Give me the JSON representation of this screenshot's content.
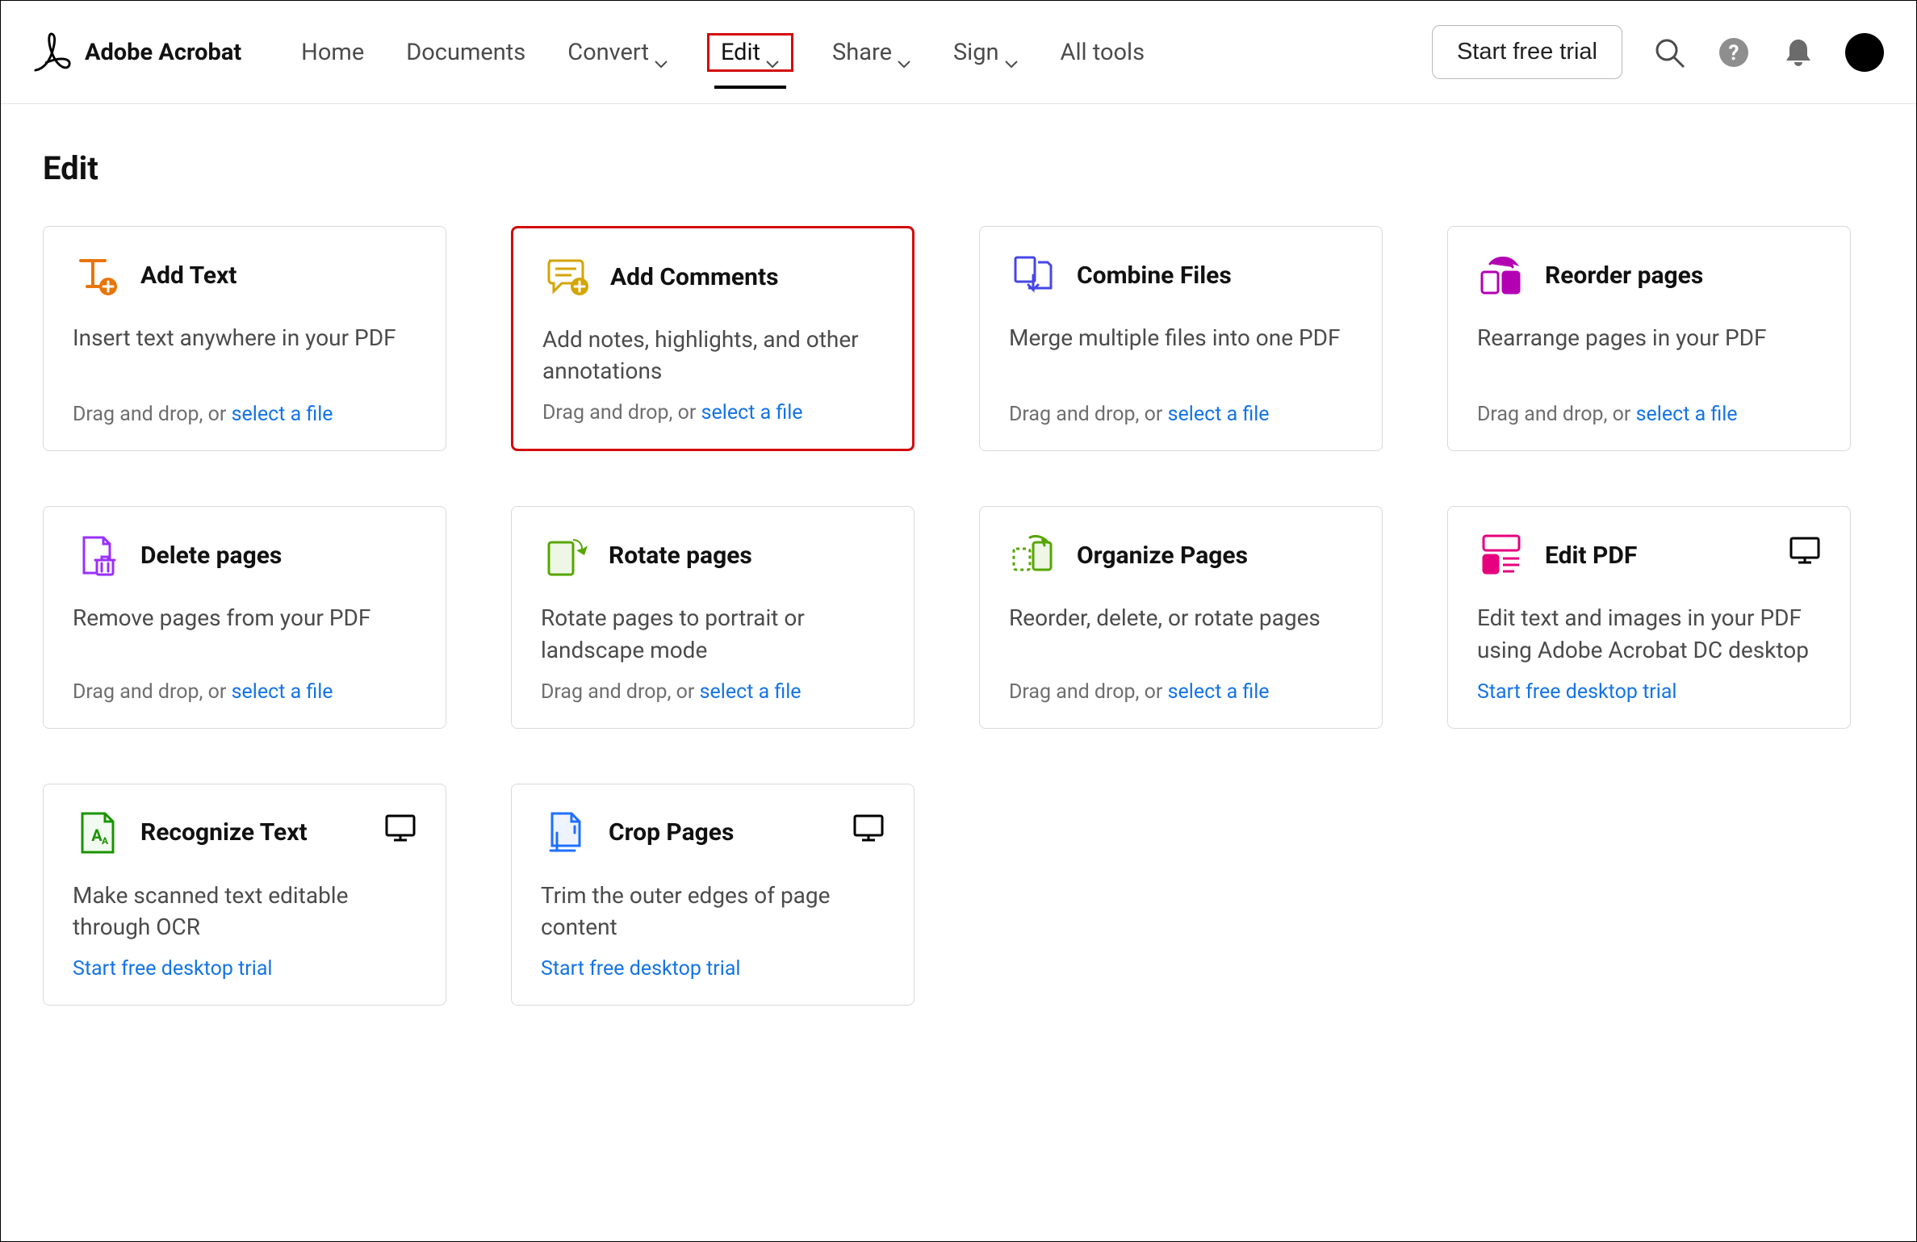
{
  "brand": {
    "name": "Adobe Acrobat"
  },
  "nav": {
    "home": "Home",
    "documents": "Documents",
    "convert": "Convert",
    "edit": "Edit",
    "share": "Share",
    "sign": "Sign",
    "alltools": "All tools"
  },
  "cta": {
    "start": "Start free trial"
  },
  "page": {
    "title": "Edit",
    "drag_prefix": "Drag and drop, or ",
    "select_file": "select a file",
    "desktop_trial": "Start free desktop trial"
  },
  "cards": {
    "addtext": {
      "title": "Add Text",
      "desc": "Insert text anywhere in your PDF"
    },
    "comments": {
      "title": "Add Comments",
      "desc": "Add notes, highlights, and other annotations"
    },
    "combine": {
      "title": "Combine Files",
      "desc": "Merge multiple files into one PDF"
    },
    "reorder": {
      "title": "Reorder pages",
      "desc": "Rearrange pages in your PDF"
    },
    "delete": {
      "title": "Delete pages",
      "desc": "Remove pages from your PDF"
    },
    "rotate": {
      "title": "Rotate pages",
      "desc": "Rotate pages to portrait or landscape mode"
    },
    "organize": {
      "title": "Organize Pages",
      "desc": "Reorder, delete, or rotate pages"
    },
    "editpdf": {
      "title": "Edit PDF",
      "desc": "Edit text and images in your PDF using Adobe Acrobat DC desktop"
    },
    "recognize": {
      "title": "Recognize Text",
      "desc": "Make scanned text editable through OCR"
    },
    "crop": {
      "title": "Crop Pages",
      "desc": "Trim the outer edges of page content"
    }
  }
}
